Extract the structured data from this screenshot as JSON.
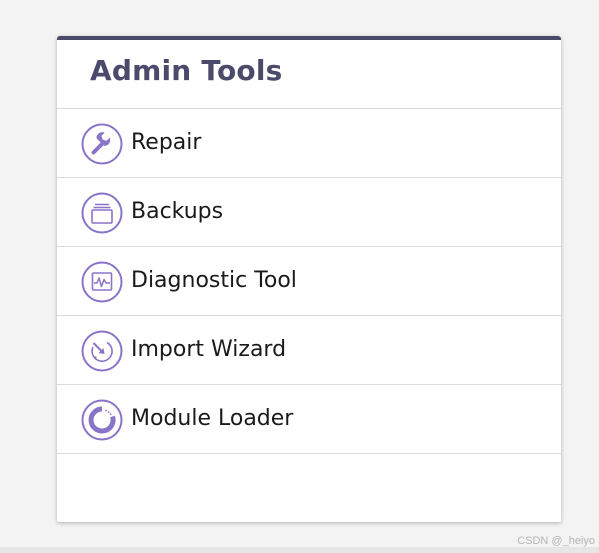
{
  "panel": {
    "title": "Admin Tools",
    "accent_color": "#4b4a6a",
    "icon_color": "#8a74c8",
    "items": [
      {
        "label": "Repair",
        "icon": "wrench-icon"
      },
      {
        "label": "Backups",
        "icon": "backup-icon"
      },
      {
        "label": "Diagnostic Tool",
        "icon": "pulse-monitor-icon"
      },
      {
        "label": "Import Wizard",
        "icon": "import-wizard-icon"
      },
      {
        "label": "Module Loader",
        "icon": "loader-icon"
      }
    ]
  },
  "watermark": "CSDN @_heiyo"
}
